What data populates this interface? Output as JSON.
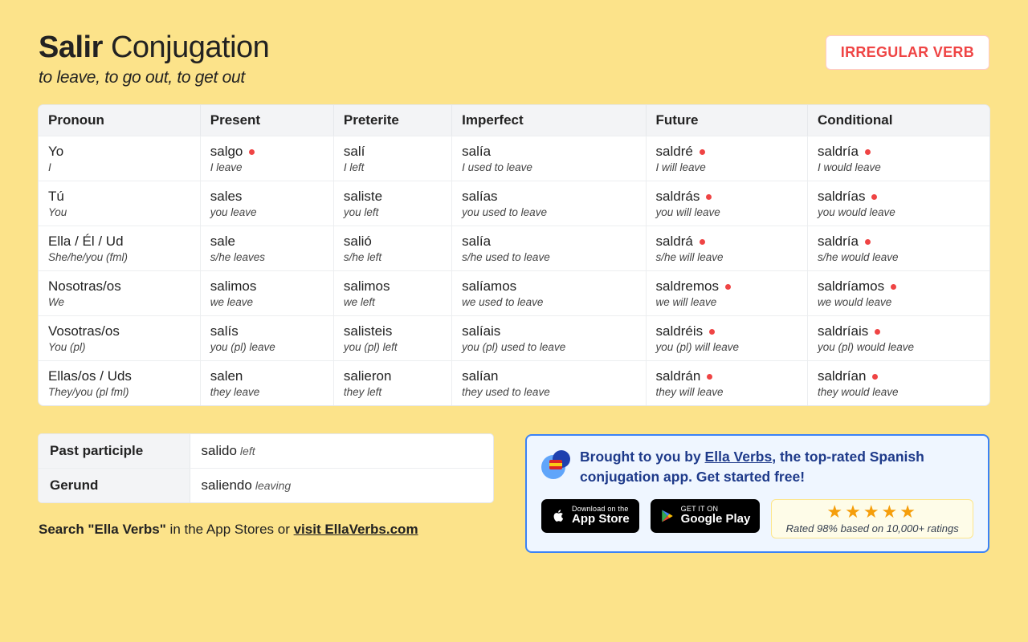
{
  "header": {
    "verb": "Salir",
    "suffix": "Conjugation",
    "translation": "to leave, to go out, to get out",
    "badge": "IRREGULAR VERB"
  },
  "columns": [
    "Pronoun",
    "Present",
    "Preterite",
    "Imperfect",
    "Future",
    "Conditional"
  ],
  "rows": [
    {
      "pronoun": "Yo",
      "pronoun_gloss": "I",
      "cells": [
        {
          "w": "salgo",
          "g": "I leave",
          "irr": true
        },
        {
          "w": "salí",
          "g": "I left",
          "irr": false
        },
        {
          "w": "salía",
          "g": "I used to leave",
          "irr": false
        },
        {
          "w": "saldré",
          "g": "I will leave",
          "irr": true
        },
        {
          "w": "saldría",
          "g": "I would leave",
          "irr": true
        }
      ]
    },
    {
      "pronoun": "Tú",
      "pronoun_gloss": "You",
      "cells": [
        {
          "w": "sales",
          "g": "you leave",
          "irr": false
        },
        {
          "w": "saliste",
          "g": "you left",
          "irr": false
        },
        {
          "w": "salías",
          "g": "you used to leave",
          "irr": false
        },
        {
          "w": "saldrás",
          "g": "you will leave",
          "irr": true
        },
        {
          "w": "saldrías",
          "g": "you would leave",
          "irr": true
        }
      ]
    },
    {
      "pronoun": "Ella / Él / Ud",
      "pronoun_gloss": "She/he/you (fml)",
      "cells": [
        {
          "w": "sale",
          "g": "s/he leaves",
          "irr": false
        },
        {
          "w": "salió",
          "g": "s/he left",
          "irr": false
        },
        {
          "w": "salía",
          "g": "s/he used to leave",
          "irr": false
        },
        {
          "w": "saldrá",
          "g": "s/he will leave",
          "irr": true
        },
        {
          "w": "saldría",
          "g": "s/he would leave",
          "irr": true
        }
      ]
    },
    {
      "pronoun": "Nosotras/os",
      "pronoun_gloss": "We",
      "cells": [
        {
          "w": "salimos",
          "g": "we leave",
          "irr": false
        },
        {
          "w": "salimos",
          "g": "we left",
          "irr": false
        },
        {
          "w": "salíamos",
          "g": "we used to leave",
          "irr": false
        },
        {
          "w": "saldremos",
          "g": "we will leave",
          "irr": true
        },
        {
          "w": "saldríamos",
          "g": "we would leave",
          "irr": true
        }
      ]
    },
    {
      "pronoun": "Vosotras/os",
      "pronoun_gloss": "You (pl)",
      "cells": [
        {
          "w": "salís",
          "g": "you (pl) leave",
          "irr": false
        },
        {
          "w": "salisteis",
          "g": "you (pl) left",
          "irr": false
        },
        {
          "w": "salíais",
          "g": "you (pl) used to leave",
          "irr": false
        },
        {
          "w": "saldréis",
          "g": "you (pl) will leave",
          "irr": true
        },
        {
          "w": "saldríais",
          "g": "you (pl) would leave",
          "irr": true
        }
      ]
    },
    {
      "pronoun": "Ellas/os / Uds",
      "pronoun_gloss": "They/you (pl fml)",
      "cells": [
        {
          "w": "salen",
          "g": "they leave",
          "irr": false
        },
        {
          "w": "salieron",
          "g": "they left",
          "irr": false
        },
        {
          "w": "salían",
          "g": "they used to leave",
          "irr": false
        },
        {
          "w": "saldrán",
          "g": "they will leave",
          "irr": true
        },
        {
          "w": "saldrían",
          "g": "they would leave",
          "irr": true
        }
      ]
    }
  ],
  "parts": {
    "pp_label": "Past participle",
    "pp_word": "salido",
    "pp_gloss": "left",
    "ger_label": "Gerund",
    "ger_word": "saliendo",
    "ger_gloss": "leaving"
  },
  "search_line": {
    "bold": "Search \"Ella Verbs\"",
    "mid": " in the App Stores or ",
    "link": "visit EllaVerbs.com"
  },
  "promo": {
    "prefix": "Brought to you by ",
    "link": "Ella Verbs",
    "suffix": ", the top-rated Spanish conjugation app. Get started free!",
    "appstore_small": "Download on the",
    "appstore_big": "App Store",
    "play_small": "GET IT ON",
    "play_big": "Google Play",
    "rating_text": "Rated 98% based on 10,000+ ratings"
  }
}
